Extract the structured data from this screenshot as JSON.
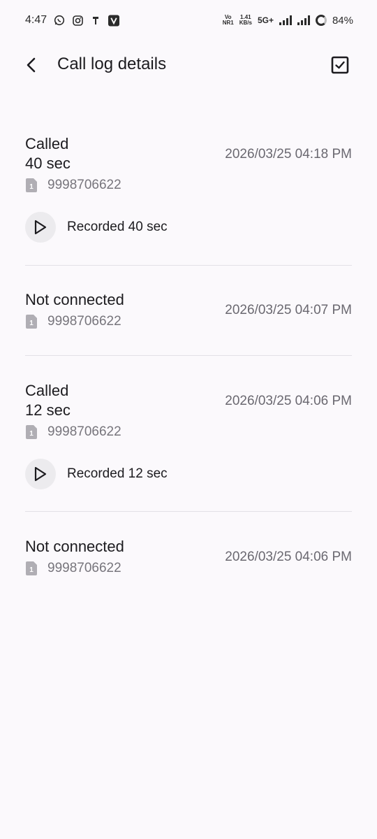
{
  "status_bar": {
    "time": "4:47",
    "volte_top": "Vo",
    "volte_bottom": "NR1",
    "speed_value": "1.41",
    "speed_unit": "KB/s",
    "network": "5G+",
    "battery": "84%"
  },
  "app_bar": {
    "title": "Call log details"
  },
  "entries": [
    {
      "status": "Called",
      "duration": "40 sec",
      "datetime": "2026/03/25 04:18 PM",
      "sim": "1",
      "number": "9998706622",
      "recording_label": "Recorded 40 sec"
    },
    {
      "status": "Not connected",
      "datetime": "2026/03/25 04:07 PM",
      "sim": "1",
      "number": "9998706622"
    },
    {
      "status": "Called",
      "duration": "12 sec",
      "datetime": "2026/03/25 04:06 PM",
      "sim": "1",
      "number": "9998706622",
      "recording_label": "Recorded 12 sec"
    },
    {
      "status": "Not connected",
      "datetime": "2026/03/25 04:06 PM",
      "sim": "1",
      "number": "9998706622"
    }
  ],
  "colors": {
    "background": "#fbf9fc",
    "primary_text": "#1c1b1f",
    "secondary_text": "#6a6870",
    "play_button_bg": "#ecebee"
  }
}
